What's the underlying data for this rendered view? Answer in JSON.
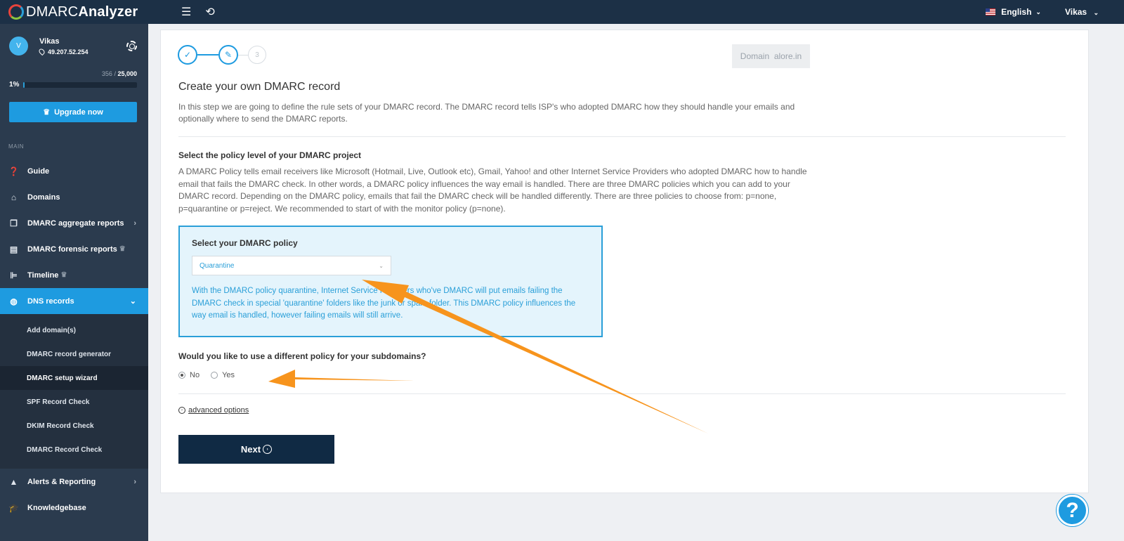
{
  "topbar": {
    "logo_light": "DMARC",
    "logo_bold": "Analyzer",
    "language": "English",
    "user": "Vikas"
  },
  "profile": {
    "initial": "V",
    "name": "Vikas",
    "ip": "49.207.52.254",
    "quota_used": "356",
    "quota_total": "25,000",
    "percent": "1%",
    "percent_value": 0.014,
    "upgrade_label": "Upgrade now"
  },
  "sidebar": {
    "section": "MAIN",
    "items": [
      {
        "label": "Guide",
        "icon": "question-icon"
      },
      {
        "label": "Domains",
        "icon": "home-icon"
      },
      {
        "label": "DMARC aggregate reports",
        "icon": "copy-icon"
      },
      {
        "label": "DMARC forensic reports",
        "icon": "document-icon"
      },
      {
        "label": "Timeline",
        "icon": "timeline-icon"
      },
      {
        "label": "DNS records",
        "icon": "globe-icon"
      },
      {
        "label": "Alerts & Reporting",
        "icon": "warning-icon"
      },
      {
        "label": "Knowledgebase",
        "icon": "graduation-cap-icon"
      }
    ],
    "sub_items": [
      {
        "label": "Add domain(s)"
      },
      {
        "label": "DMARC record generator"
      },
      {
        "label": "DMARC setup wizard"
      },
      {
        "label": "SPF Record Check"
      },
      {
        "label": "DKIM Record Check"
      },
      {
        "label": "DMARC Record Check"
      }
    ]
  },
  "wizard": {
    "step3": "3",
    "domain_label": "Domain",
    "domain_value": "alore.in",
    "title": "Create your own DMARC record",
    "intro": "In this step we are going to define the rule sets of your DMARC record. The DMARC record tells ISP's who adopted DMARC how they should handle your emails and optionally where to send the DMARC reports.",
    "policy_section_title": "Select the policy level of your DMARC project",
    "policy_section_body": "A DMARC Policy tells email receivers like Microsoft (Hotmail, Live, Outlook etc), Gmail, Yahoo! and other Internet Service Providers who adopted DMARC how to handle email that fails the DMARC check. In other words, a DMARC policy influences the way email is handled. There are three DMARC policies which you can add to your DMARC record. Depending on the DMARC policy, emails that fail the DMARC check will be handled differently. There are three policies to choose from: p=none, p=quarantine or p=reject. We recommended to start of with the monitor policy (p=none).",
    "policy_box_title": "Select your DMARC policy",
    "policy_selected": "Quarantine",
    "policy_description": "With the DMARC policy quarantine, Internet Service Providers who've DMARC will put emails failing the DMARC check in special 'quarantine' folders like the junk or spam folder. This DMARC policy influences the way email is handled, however failing emails will still arrive.",
    "subdomain_question": "Would you like to use a different policy for your subdomains?",
    "radio_no": "No",
    "radio_yes": "Yes",
    "advanced_label": "advanced options",
    "next_label": "Next"
  },
  "help_label": "?",
  "colors": {
    "topbar": "#1c3046",
    "sidebar": "#2b3b4e",
    "accent": "#1e9be0",
    "next_button": "#102a44",
    "annotation_arrow": "#f7941d"
  }
}
